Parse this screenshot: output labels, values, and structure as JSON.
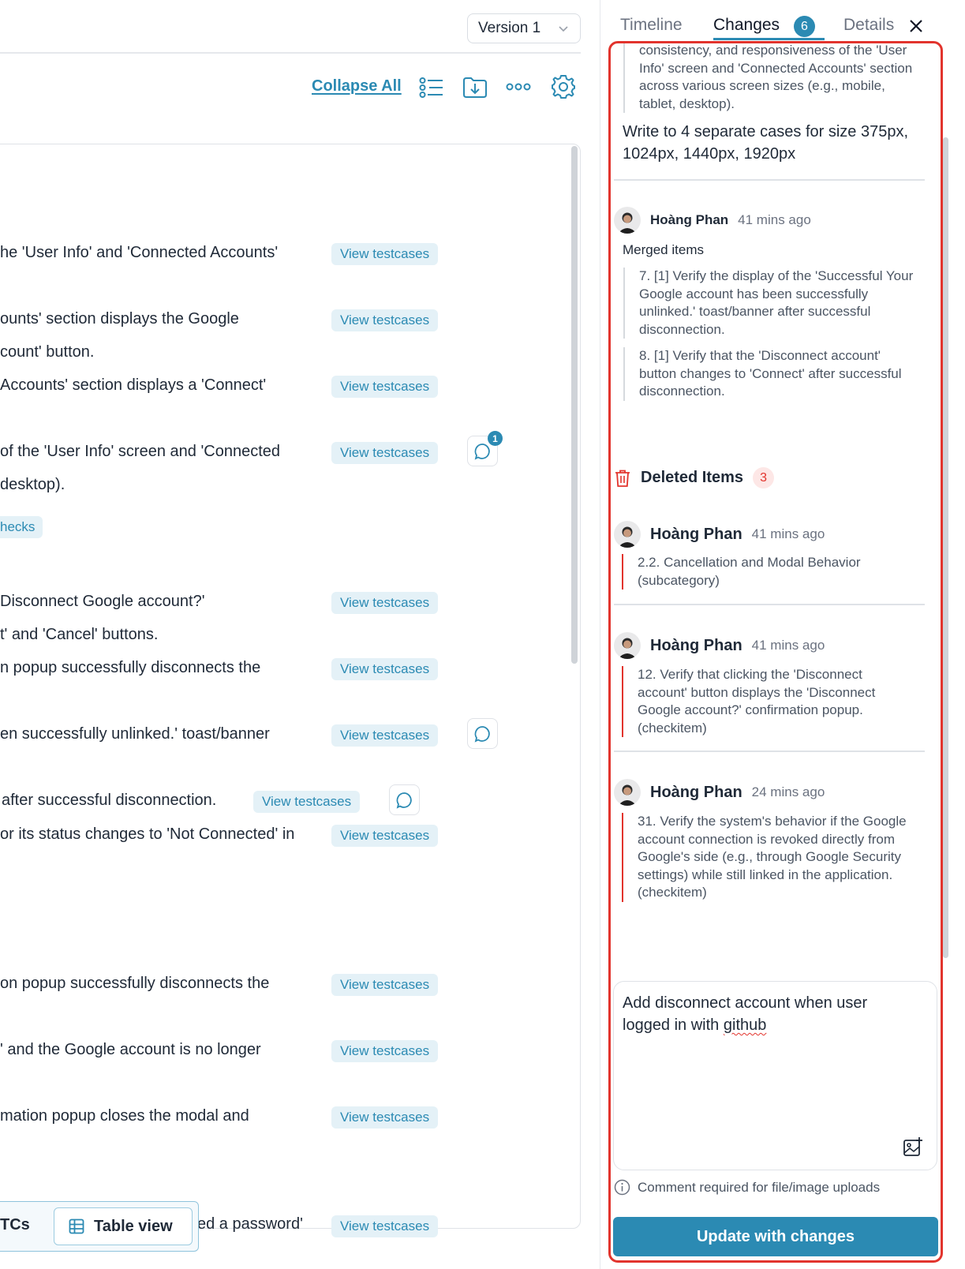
{
  "left": {
    "version_label": "Version 1",
    "collapse_all": "Collapse All",
    "rows": [
      {
        "text": "he 'User Info' and 'Connected Accounts'",
        "button": "View testcases"
      },
      {
        "text": "ounts' section displays the Google",
        "button": "View testcases"
      },
      {
        "text": "count' button."
      },
      {
        "text": "Accounts' section displays a 'Connect'",
        "button": "View testcases"
      },
      {
        "text": "of the 'User Info' screen and 'Connected",
        "button": "View testcases",
        "comments": "1"
      },
      {
        "text": "desktop)."
      },
      {
        "chip": "hecks"
      },
      {
        "text": "Disconnect Google account?'",
        "button": "View testcases"
      },
      {
        "text": "t' and 'Cancel' buttons."
      },
      {
        "text": "n popup successfully disconnects the",
        "button": "View testcases"
      },
      {
        "text": "en successfully unlinked.' toast/banner",
        "button": "View testcases"
      },
      {
        "text": "after successful disconnection.",
        "button": "View testcases"
      },
      {
        "text": "or its status changes to 'Not Connected' in",
        "button": "View testcases"
      },
      {
        "text": "on popup successfully disconnects the",
        "button": "View testcases"
      },
      {
        "text": "' and the Google account is no longer",
        "button": "View testcases"
      },
      {
        "text": "mation popup closes the modal and",
        "button": "View testcases"
      },
      {
        "text": "ed a password'",
        "button": "View testcases"
      }
    ],
    "bottom": {
      "tcs": "TCs",
      "table_view": "Table view"
    }
  },
  "right": {
    "tabs": [
      {
        "label": "Timeline"
      },
      {
        "label": "Changes",
        "badge": "6"
      },
      {
        "label": "Details"
      }
    ],
    "top_quote": "consistency, and responsiveness of the 'User Info' screen and 'Connected Accounts' section across various screen sizes (e.g., mobile, tablet, desktop).",
    "top_note": "Write to 4 separate cases for size 375px, 1024px, 1440px, 1920px",
    "merged_entry": {
      "author": "Hoàng Phan",
      "time": "41 mins ago",
      "label": "Merged items",
      "items": [
        "7. [1] Verify the display of the 'Successful Your Google account has been successfully unlinked.' toast/banner after successful disconnection.",
        "8. [1] Verify that the 'Disconnect account' button changes to 'Connect' after successful disconnection."
      ]
    },
    "deleted": {
      "title": "Deleted Items",
      "count": "3",
      "entries": [
        {
          "author": "Hoàng Phan",
          "time": "41 mins ago",
          "text": "2.2. Cancellation and Modal Behavior (subcategory)"
        },
        {
          "author": "Hoàng Phan",
          "time": "41 mins ago",
          "text": "12. Verify that clicking the 'Disconnect account' button displays the 'Disconnect Google account?' confirmation popup. (checkitem)"
        },
        {
          "author": "Hoàng Phan",
          "time": "24 mins ago",
          "text": "31. Verify the system's behavior if the Google account connection is revoked directly from Google's side (e.g., through Google Security settings) while still linked in the application. (checkitem)"
        }
      ]
    },
    "comment": {
      "line1": "Add disconnect account when user",
      "line2_prefix": "logged in with ",
      "line2_misspelled": "github"
    },
    "info_text": "Comment required for file/image uploads",
    "update_button": "Update with changes",
    "colors": {
      "accent": "#2b8ab3",
      "danger": "#e2342d"
    }
  }
}
